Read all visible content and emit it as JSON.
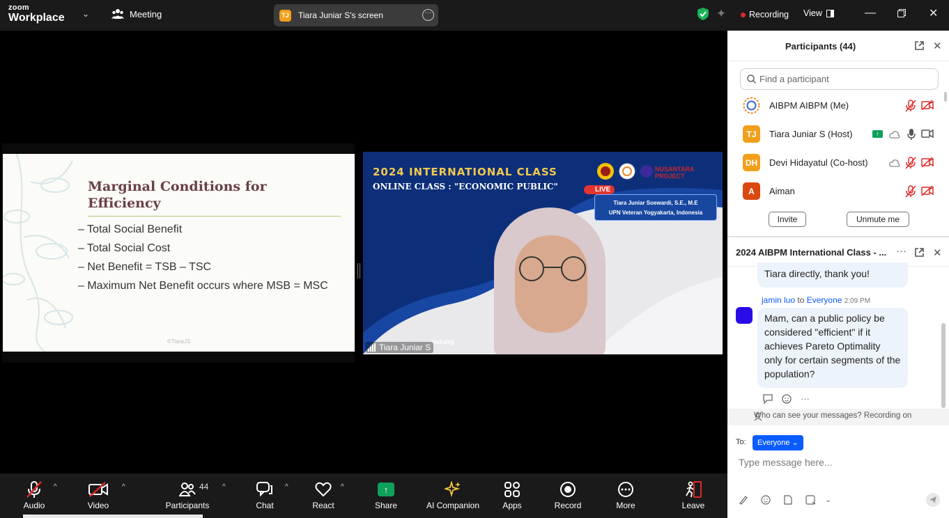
{
  "app": {
    "logo_top": "zoom",
    "logo_bottom": "Workplace",
    "meeting_label": "Meeting",
    "screen_owner_initials": "TJ",
    "screen_title": "Tiara Juniar S's screen",
    "recording_label": "Recording",
    "view_label": "View"
  },
  "slide": {
    "title_line1": "Marginal Conditions for",
    "title_line2": "Efficiency",
    "bullets": [
      "– Total Social Benefit",
      "– Total Social Cost",
      "– Net Benefit = TSB – TSC",
      "– Maximum Net Benefit occurs where MSB = MSC"
    ],
    "copyright": "©TiaraJS"
  },
  "video": {
    "banner_line1": "2024 INTERNATIONAL CLASS",
    "banner_line2": "ONLINE CLASS : \"ECONOMIC PUBLIC\"",
    "live": "LIVE",
    "brand": "NUSANTARA PROJECT",
    "card_line1": "Tiara Juniar Soewardi, S.E., M.E",
    "card_line2": "UPN Veteran Yogyakarta, Indonesia",
    "site_fragment": "ject.org",
    "name_tag": "Tiara Juniar S"
  },
  "toolbar": {
    "audio": "Audio",
    "video": "Video",
    "participants": "Participants",
    "participants_count": "44",
    "chat": "Chat",
    "react": "React",
    "share": "Share",
    "ai_companion": "AI Companion",
    "apps": "Apps",
    "record": "Record",
    "more": "More",
    "leave": "Leave"
  },
  "participants": {
    "title": "Participants (44)",
    "search_placeholder": "Find a participant",
    "list": [
      {
        "initials": "",
        "name": "AIBPM AIBPM (Me)",
        "color": "#ffffff"
      },
      {
        "initials": "TJ",
        "name": "Tiara Juniar S (Host)",
        "color": "#f29f1b"
      },
      {
        "initials": "DH",
        "name": "Devi Hidayatul (Co-host)",
        "color": "#f29f1b"
      },
      {
        "initials": "A",
        "name": "Aiman",
        "color": "#d9480f"
      }
    ],
    "invite": "Invite",
    "unmute": "Unmute me"
  },
  "chat": {
    "title": "2024 AIBPM International Class - ...",
    "prev_message_tail": "Tiara directly, thank you!",
    "sender": "jamin luo",
    "to_word": "to",
    "recipient": "Everyone",
    "time": "2:09 PM",
    "message": "Mam, can a public policy be considered \"efficient\" if it achieves Pareto Optimality only for certain segments of the population?",
    "visibility_note": "Who can see your messages? Recording on",
    "to_label": "To:",
    "to_value": "Everyone",
    "input_placeholder": "Type message here..."
  },
  "colors": {
    "accent_blue": "#0b5cff",
    "recording_red": "#e02828",
    "share_green": "#0fa05a",
    "muted_red": "#e02828"
  }
}
